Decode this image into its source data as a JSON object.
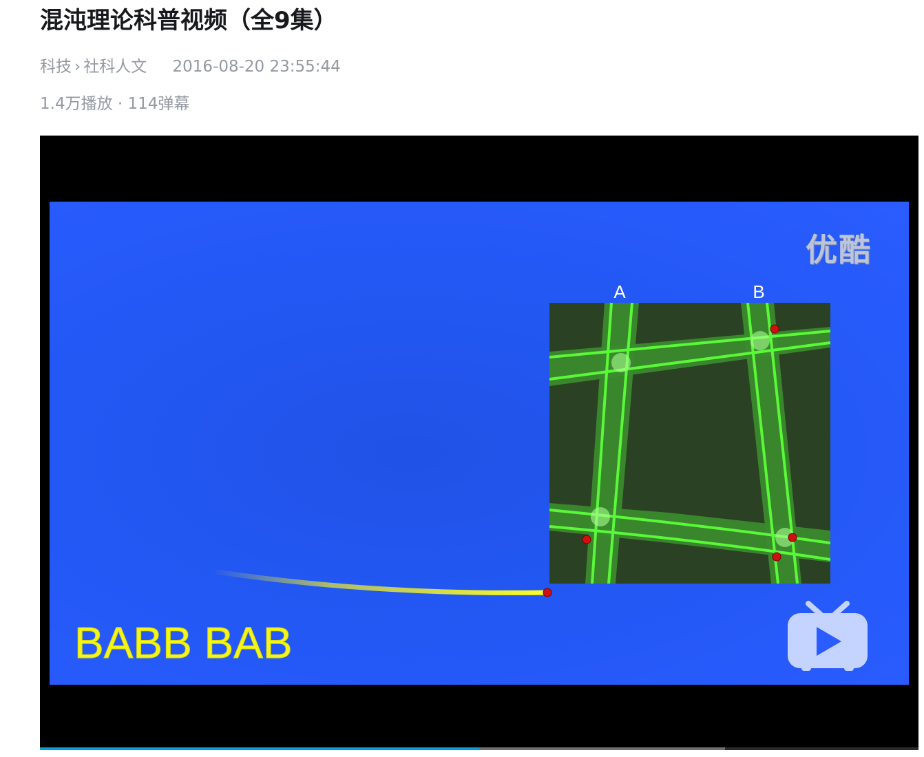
{
  "video": {
    "title": "混沌理论科普视频（全9集）",
    "category": "科技",
    "subcategory": "社科人文",
    "category_separator": "›",
    "publish_time": "2016-08-20 23:55:44",
    "views": "1.4万播放",
    "stats_separator": "·",
    "danmaku": "114弹幕"
  },
  "player": {
    "watermark": "优酷",
    "caption": "BABB BAB",
    "label_a": "A",
    "label_b": "B",
    "play_icon": "bilibili-tv-play-icon",
    "progress_fraction": 0.5,
    "buffered_fraction": 0.78
  },
  "colors": {
    "background_blue": "#2a5cff",
    "caption_yellow": "#f5f51e",
    "band_green": "#3ddc2e",
    "progress_blue": "#00a1d6"
  }
}
